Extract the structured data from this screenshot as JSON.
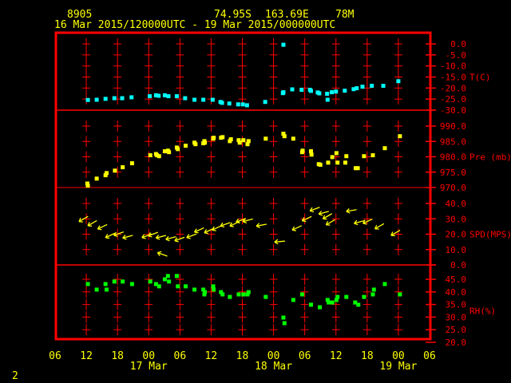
{
  "header": {
    "station": "8905",
    "lat": "74.95S",
    "lon": "163.69E",
    "elev": "78M",
    "period": "16 Mar 2015/120000UTC - 19 Mar 2015/000000UTC"
  },
  "footer": {
    "page": "2"
  },
  "colors": {
    "frame": "#ff0000",
    "text": "#ffff00",
    "temp": "#00ffff",
    "pres": "#ffff00",
    "wind": "#ffff00",
    "rh": "#00ff00"
  },
  "chart_data": {
    "type": "scatter",
    "x_unit": "hours since 16 Mar 2015 06 UTC",
    "xlim": [
      0,
      72
    ],
    "x_tick_labels": [
      "06",
      "12",
      "18",
      "00",
      "06",
      "12",
      "18",
      "00",
      "06",
      "12",
      "18",
      "00",
      "06"
    ],
    "date_labels": [
      {
        "label": "17 Mar",
        "hour": 18
      },
      {
        "label": "18 Mar",
        "hour": 42
      },
      {
        "label": "19 Mar",
        "hour": 66
      }
    ],
    "panels": [
      {
        "name": "temperature",
        "ylabel": "T(C)",
        "ylim": [
          -30,
          0
        ],
        "yticks": [
          "0.0",
          "-5.0",
          "-10.0",
          "-15.0",
          "-20.0",
          "-25.0",
          "-30.0"
        ],
        "marker": "square",
        "color": "#00ffff",
        "points": [
          [
            6.3,
            -25.4
          ],
          [
            8.0,
            -25.3
          ],
          [
            9.7,
            -24.9
          ],
          [
            11.4,
            -24.6
          ],
          [
            12.9,
            -24.6
          ],
          [
            14.7,
            -24.2
          ],
          [
            18.2,
            -23.7
          ],
          [
            19.4,
            -23.3
          ],
          [
            19.9,
            -23.5
          ],
          [
            21.1,
            -23.3
          ],
          [
            21.8,
            -23.7
          ],
          [
            23.4,
            -23.7
          ],
          [
            25.0,
            -24.6
          ],
          [
            26.8,
            -25.3
          ],
          [
            28.5,
            -25.3
          ],
          [
            30.3,
            -25.3
          ],
          [
            31.8,
            -26.3
          ],
          [
            32.1,
            -26.7
          ],
          [
            33.5,
            -27.0
          ],
          [
            35.2,
            -27.4
          ],
          [
            36.1,
            -27.4
          ],
          [
            36.9,
            -27.8
          ],
          [
            40.4,
            -26.3
          ],
          [
            43.9,
            -0.4
          ],
          [
            43.8,
            -22.3
          ],
          [
            43.9,
            -21.9
          ],
          [
            45.6,
            -20.6
          ],
          [
            47.4,
            -20.8
          ],
          [
            49.0,
            -20.8
          ],
          [
            49.2,
            -21.3
          ],
          [
            50.5,
            -22.0
          ],
          [
            50.8,
            -22.4
          ],
          [
            52.3,
            -22.6
          ],
          [
            52.4,
            -25.3
          ],
          [
            53.2,
            -21.9
          ],
          [
            54.0,
            -21.6
          ],
          [
            55.7,
            -21.2
          ],
          [
            57.4,
            -20.5
          ],
          [
            58.0,
            -20.1
          ],
          [
            59.1,
            -19.4
          ],
          [
            60.9,
            -19.0
          ],
          [
            63.1,
            -19.0
          ],
          [
            66.0,
            -16.9
          ]
        ]
      },
      {
        "name": "pressure",
        "ylabel": "Pre (mb)",
        "ylim": [
          970,
          990
        ],
        "yticks": [
          "990.0",
          "985.0",
          "980.0",
          "975.0",
          "970.0"
        ],
        "marker": "square",
        "color": "#ffff00",
        "points": [
          [
            6.2,
            971.3
          ],
          [
            6.3,
            970.6
          ],
          [
            8.0,
            972.9
          ],
          [
            9.7,
            974.0
          ],
          [
            9.9,
            974.7
          ],
          [
            11.5,
            975.5
          ],
          [
            13.0,
            976.6
          ],
          [
            14.8,
            977.9
          ],
          [
            18.3,
            980.5
          ],
          [
            19.4,
            980.9
          ],
          [
            19.6,
            980.5
          ],
          [
            20.0,
            980.2
          ],
          [
            21.1,
            981.8
          ],
          [
            21.7,
            982.0
          ],
          [
            21.9,
            981.5
          ],
          [
            23.4,
            983.0
          ],
          [
            23.6,
            982.5
          ],
          [
            25.1,
            983.6
          ],
          [
            26.8,
            984.6
          ],
          [
            27.0,
            984.1
          ],
          [
            28.5,
            984.4
          ],
          [
            28.7,
            985.1
          ],
          [
            28.8,
            984.6
          ],
          [
            30.4,
            985.9
          ],
          [
            30.5,
            986.2
          ],
          [
            31.9,
            986.2
          ],
          [
            32.2,
            986.4
          ],
          [
            33.6,
            985.1
          ],
          [
            33.8,
            985.7
          ],
          [
            35.3,
            985.4
          ],
          [
            35.5,
            984.6
          ],
          [
            36.2,
            985.4
          ],
          [
            37.0,
            984.1
          ],
          [
            37.2,
            985.1
          ],
          [
            40.5,
            985.9
          ],
          [
            43.9,
            987.5
          ],
          [
            44.1,
            986.7
          ],
          [
            45.8,
            985.9
          ],
          [
            47.6,
            982.0
          ],
          [
            47.5,
            981.5
          ],
          [
            49.2,
            981.8
          ],
          [
            49.3,
            980.7
          ],
          [
            50.7,
            977.6
          ],
          [
            51.0,
            977.4
          ],
          [
            52.5,
            978.1
          ],
          [
            53.3,
            979.9
          ],
          [
            54.1,
            981.2
          ],
          [
            54.3,
            978.1
          ],
          [
            55.8,
            978.1
          ],
          [
            56.0,
            980.2
          ],
          [
            57.8,
            976.3
          ],
          [
            58.2,
            976.3
          ],
          [
            59.4,
            980.2
          ],
          [
            61.1,
            980.5
          ],
          [
            63.4,
            982.8
          ],
          [
            66.3,
            986.7
          ]
        ]
      },
      {
        "name": "wind",
        "ylabel": "SPD(MPS)",
        "ylim": [
          0,
          40
        ],
        "yticks": [
          "40.0",
          "30.0",
          "20.0",
          "10.0",
          "0.0"
        ],
        "marker": "arrow",
        "color": "#ffff00",
        "points": [
          [
            4.6,
            28.2,
            60
          ],
          [
            6.3,
            25.5,
            60
          ],
          [
            8.2,
            23.4,
            65
          ],
          [
            9.7,
            17.8,
            65
          ],
          [
            11.3,
            19.2,
            70
          ],
          [
            13.0,
            17.5,
            75
          ],
          [
            16.7,
            17.8,
            70
          ],
          [
            17.9,
            18.9,
            70
          ],
          [
            19.4,
            17.5,
            75
          ],
          [
            19.7,
            8.0,
            110
          ],
          [
            21.3,
            16.6,
            75
          ],
          [
            23.0,
            15.7,
            70
          ],
          [
            25.3,
            17.8,
            70
          ],
          [
            26.8,
            21.3,
            65
          ],
          [
            28.7,
            20.9,
            65
          ],
          [
            30.2,
            22.7,
            65
          ],
          [
            31.8,
            25.3,
            70
          ],
          [
            33.6,
            25.3,
            65
          ],
          [
            34.8,
            27.9,
            70
          ],
          [
            36.1,
            28.2,
            75
          ],
          [
            38.7,
            25.3,
            80
          ],
          [
            42.2,
            14.9,
            85
          ],
          [
            45.6,
            22.7,
            65
          ],
          [
            47.5,
            28.7,
            65
          ],
          [
            49.0,
            35.2,
            70
          ],
          [
            50.7,
            33.1,
            75
          ],
          [
            51.5,
            30.0,
            60
          ],
          [
            52.1,
            26.1,
            60
          ],
          [
            56.0,
            34.8,
            80
          ],
          [
            57.5,
            27.0,
            75
          ],
          [
            59.2,
            27.0,
            65
          ],
          [
            61.5,
            23.5,
            60
          ],
          [
            64.6,
            19.2,
            60
          ]
        ]
      },
      {
        "name": "humidity",
        "ylabel": "RH(%)",
        "ylim": [
          20,
          45
        ],
        "yticks": [
          "45.0",
          "40.0",
          "35.0",
          "30.0",
          "25.0",
          "20.0"
        ],
        "marker": "square",
        "color": "#00ff00",
        "points": [
          [
            6.3,
            43.1
          ],
          [
            8.0,
            40.9
          ],
          [
            9.7,
            43.1
          ],
          [
            9.9,
            40.9
          ],
          [
            11.4,
            44.1
          ],
          [
            13.0,
            44.1
          ],
          [
            14.8,
            43.1
          ],
          [
            18.3,
            44.1
          ],
          [
            19.4,
            43.1
          ],
          [
            20.0,
            42.2
          ],
          [
            21.1,
            45.0
          ],
          [
            21.7,
            46.3
          ],
          [
            21.9,
            44.1
          ],
          [
            23.4,
            46.3
          ],
          [
            23.6,
            42.2
          ],
          [
            25.1,
            42.2
          ],
          [
            26.8,
            40.9
          ],
          [
            28.5,
            40.9
          ],
          [
            28.8,
            39.9
          ],
          [
            28.7,
            39.0
          ],
          [
            30.4,
            42.2
          ],
          [
            30.5,
            40.9
          ],
          [
            31.9,
            39.9
          ],
          [
            32.2,
            39.0
          ],
          [
            33.6,
            38.0
          ],
          [
            35.3,
            39.0
          ],
          [
            36.2,
            39.0
          ],
          [
            37.0,
            39.0
          ],
          [
            37.2,
            39.9
          ],
          [
            40.5,
            38.0
          ],
          [
            43.9,
            29.8
          ],
          [
            44.1,
            27.6
          ],
          [
            45.8,
            36.8
          ],
          [
            47.5,
            39.0
          ],
          [
            49.2,
            34.9
          ],
          [
            50.9,
            33.9
          ],
          [
            52.4,
            36.8
          ],
          [
            52.6,
            35.8
          ],
          [
            53.3,
            35.8
          ],
          [
            54.1,
            36.8
          ],
          [
            54.3,
            38.0
          ],
          [
            56.0,
            38.0
          ],
          [
            57.7,
            35.8
          ],
          [
            58.3,
            34.9
          ],
          [
            59.4,
            38.0
          ],
          [
            61.1,
            39.0
          ],
          [
            61.3,
            40.9
          ],
          [
            63.4,
            43.1
          ],
          [
            66.3,
            39.0
          ]
        ]
      }
    ]
  }
}
